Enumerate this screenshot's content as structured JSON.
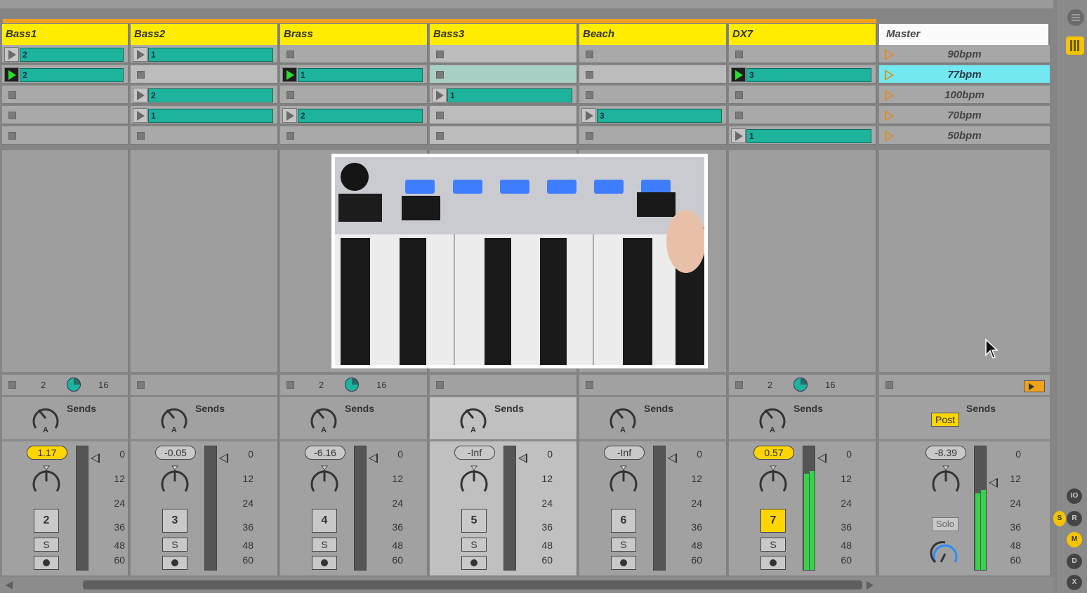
{
  "tracks": [
    {
      "name": "Bass1",
      "slots": [
        {
          "type": "clip",
          "label": "2",
          "playing": false
        },
        {
          "type": "clip",
          "label": "2",
          "playing": true
        },
        {
          "type": "stop"
        },
        {
          "type": "stop"
        },
        {
          "type": "stop"
        }
      ],
      "io": {
        "show": true,
        "n1": "2",
        "n2": "16"
      },
      "volume": "1.17",
      "vol_on": true,
      "number": "2",
      "num_on": false,
      "solo": "S",
      "meter_l": 0,
      "meter_r": 0,
      "highlight": false
    },
    {
      "name": "Bass2",
      "slots": [
        {
          "type": "clip",
          "label": "1",
          "playing": false
        },
        {
          "type": "stop",
          "lit": true
        },
        {
          "type": "clip",
          "label": "2",
          "playing": false
        },
        {
          "type": "clip",
          "label": "1",
          "playing": false
        },
        {
          "type": "stop"
        }
      ],
      "io": {
        "show": false
      },
      "volume": "-0.05",
      "vol_on": false,
      "number": "3",
      "num_on": false,
      "solo": "S",
      "meter_l": 0,
      "meter_r": 0,
      "highlight": false
    },
    {
      "name": "Brass",
      "slots": [
        {
          "type": "stop"
        },
        {
          "type": "clip",
          "label": "1",
          "playing": true
        },
        {
          "type": "stop"
        },
        {
          "type": "clip",
          "label": "2",
          "playing": false
        },
        {
          "type": "stop"
        }
      ],
      "io": {
        "show": true,
        "n1": "2",
        "n2": "16"
      },
      "volume": "-6.16",
      "vol_on": false,
      "number": "4",
      "num_on": false,
      "solo": "S",
      "meter_l": 0,
      "meter_r": 0,
      "highlight": false
    },
    {
      "name": "Bass3",
      "slots": [
        {
          "type": "stop",
          "lit": true
        },
        {
          "type": "stop",
          "lit2": true
        },
        {
          "type": "clip",
          "label": "1",
          "playing": false
        },
        {
          "type": "stop",
          "lit": true
        },
        {
          "type": "stop",
          "lit": true
        }
      ],
      "io": {
        "show": false
      },
      "volume": "-Inf",
      "vol_on": false,
      "number": "5",
      "num_on": false,
      "solo": "S",
      "meter_l": 0,
      "meter_r": 0,
      "highlight": true
    },
    {
      "name": "Beach",
      "slots": [
        {
          "type": "stop"
        },
        {
          "type": "stop",
          "lit": true
        },
        {
          "type": "stop"
        },
        {
          "type": "clip",
          "label": "3",
          "playing": false
        },
        {
          "type": "stop"
        }
      ],
      "io": {
        "show": false
      },
      "volume": "-Inf",
      "vol_on": false,
      "number": "6",
      "num_on": false,
      "solo": "S",
      "meter_l": 0,
      "meter_r": 0,
      "highlight": false
    },
    {
      "name": "DX7",
      "slots": [
        {
          "type": "stop"
        },
        {
          "type": "clip",
          "label": "3",
          "playing": true
        },
        {
          "type": "stop"
        },
        {
          "type": "stop"
        },
        {
          "type": "clip",
          "label": "1",
          "playing": false
        }
      ],
      "io": {
        "show": true,
        "n1": "2",
        "n2": "16"
      },
      "volume": "0.57",
      "vol_on": true,
      "number": "7",
      "num_on": true,
      "solo": "S",
      "meter_l": 0.78,
      "meter_r": 0.8,
      "highlight": false
    }
  ],
  "master": {
    "name": "Master",
    "scenes": [
      {
        "label": "90bpm",
        "selected": false
      },
      {
        "label": "77bpm",
        "selected": true
      },
      {
        "label": "100bpm",
        "selected": false
      },
      {
        "label": "70bpm",
        "selected": false
      },
      {
        "label": "50bpm",
        "selected": false
      }
    ],
    "volume": "-8.39",
    "post_label": "Post",
    "solo_label": "Solo",
    "meter_l": 0.62,
    "meter_r": 0.65
  },
  "sends_label": "Sends",
  "db_scale": [
    "0",
    "12",
    "24",
    "36",
    "48",
    "60"
  ],
  "side_buttons": [
    "IO",
    "S",
    "R",
    "M",
    "D",
    "X"
  ],
  "colors": {
    "track_header": "#ffec00",
    "clip": "#1db39d",
    "scene_selected": "#74e8f0",
    "orange": "#f0a21c",
    "meter": "#35d34a"
  }
}
